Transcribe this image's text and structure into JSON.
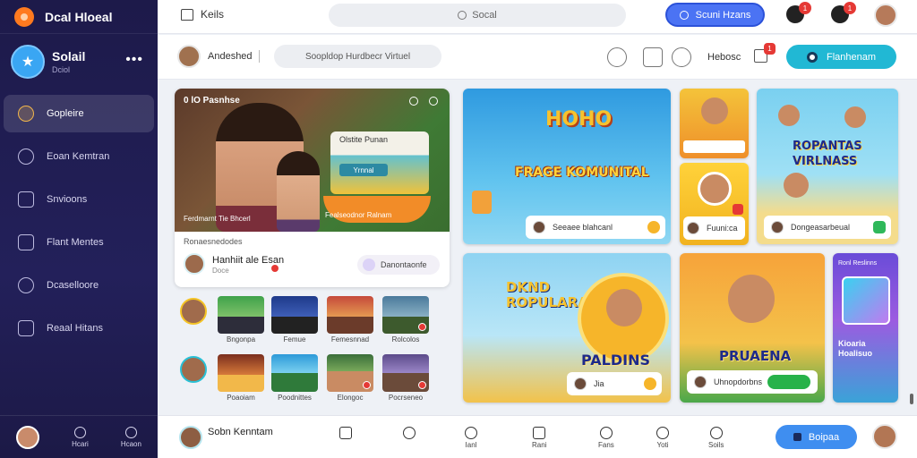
{
  "app": {
    "name": "Dcal Hloeal"
  },
  "profile": {
    "name": "Solail",
    "sub": "Dciol",
    "more": "•••"
  },
  "sidebar": {
    "items": [
      {
        "label": "Gopleire",
        "icon": "medal-icon",
        "active": true
      },
      {
        "label": "Eoan Kemtran",
        "icon": "compass-icon"
      },
      {
        "label": "Snvioons",
        "icon": "edit-icon"
      },
      {
        "label": "Flant Mentes",
        "icon": "document-icon"
      },
      {
        "label": "Dcaselloore",
        "icon": "settings-icon"
      },
      {
        "label": "Reaal Hitans",
        "icon": "share-icon"
      }
    ],
    "bottom": [
      {
        "label": "Hcari",
        "icon": "gear-icon"
      },
      {
        "label": "Hcaon",
        "icon": "clock-icon"
      }
    ]
  },
  "topbar": {
    "home_label": "Keils",
    "search_placeholder": "Socal",
    "cta_label": "Scuni Hzans",
    "badges": [
      "1",
      "1"
    ]
  },
  "subheader": {
    "user": "Andeshed",
    "pill": "Soopldop Hurdbecr Virtuel",
    "label": "Hebosc",
    "badge": "1",
    "cta_label": "Flanhenam"
  },
  "live": {
    "tag": "0 lO Pasnhse",
    "screen_title": "Olstite Punan",
    "screen_button": "Yrnnal",
    "caption_left": "Ferdmarnt Tie Bhcerl",
    "caption_right": "Fealseodnor Ralnam",
    "subtitle": "Ronaesnedodes",
    "author": "Hanhiit ale Esan",
    "author_sub": "Doce",
    "chip": "Danontaonfe"
  },
  "thumbs_row1": [
    {
      "label": "Bngonpa"
    },
    {
      "label": "Femue"
    },
    {
      "label": "Femesnnad"
    },
    {
      "label": "Rolcolos"
    }
  ],
  "thumbs_row2": [
    {
      "label": "Poaoiam"
    },
    {
      "label": "Poodnittes"
    },
    {
      "label": "Elongoc"
    },
    {
      "label": "Pocrseneo"
    }
  ],
  "cards": {
    "c1": {
      "title_top": "HOHO",
      "title": "FRAGE KOMUNITAL",
      "footer": "Seeaee blahcanl"
    },
    "c2a": {
      "footer": ""
    },
    "c2b": {
      "footer": "Fuuni:ca"
    },
    "c3": {
      "title": "ROPANTAS VIRLNASS",
      "footer": "Dongeasarbeual"
    },
    "c4": {
      "title": "DKND ROPULARA",
      "title2": "PALDINS",
      "footer": "Jia"
    },
    "c5": {
      "title": "PRUAENA",
      "footer": "Uhnopdorbns",
      "action": ""
    },
    "c6": {
      "tag": "Ronl Reslinns",
      "title": "Kioaria Hoalisuo"
    }
  },
  "bottombar": {
    "name": "Sobn Kenntam",
    "nav": [
      {
        "label": "",
        "icon": "home-icon"
      },
      {
        "label": "",
        "icon": "shield-icon"
      },
      {
        "label": "Ianl",
        "icon": "user-icon"
      },
      {
        "label": "Rani",
        "icon": "inbox-icon"
      },
      {
        "label": "Fans",
        "icon": "person-icon"
      },
      {
        "label": "Yoti",
        "icon": "chat-icon"
      },
      {
        "label": "Soils",
        "icon": "people-icon"
      }
    ],
    "cta_label": "Boipaa"
  }
}
